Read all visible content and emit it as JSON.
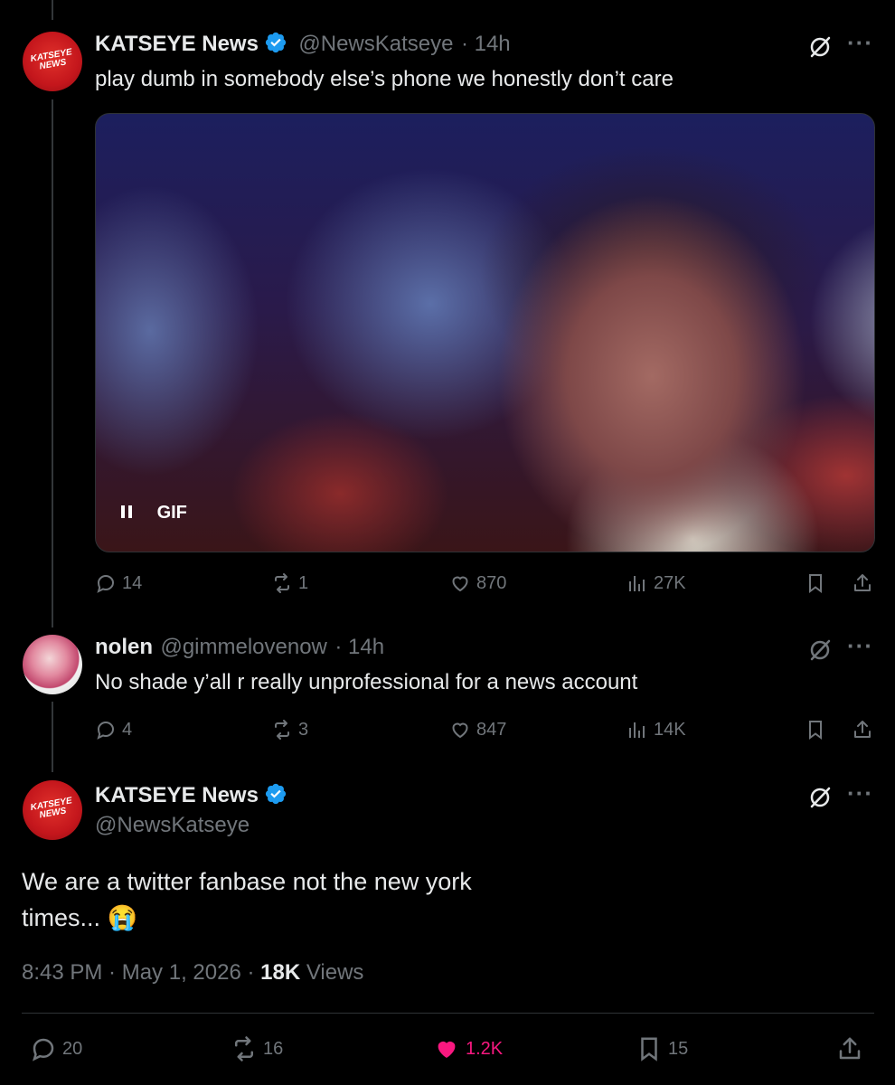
{
  "colors": {
    "background": "#000000",
    "text": "#e7e9ea",
    "muted": "#71767b",
    "verified": "#1d9bf0",
    "like_active": "#f91880"
  },
  "tweet1": {
    "name": "KATSEYE News",
    "handle": "@NewsKatseye",
    "time": "· 14h",
    "text": "play dumb in somebody else’s phone we honestly don’t care",
    "media_badge": "GIF",
    "avatar_text": "KATSEYE NEWS",
    "actions": {
      "replies": "14",
      "retweets": "1",
      "likes": "870",
      "views": "27K"
    }
  },
  "tweet2": {
    "name": "nolen",
    "handle": "@gimmelovenow",
    "time": "· 14h",
    "text": "No shade y’all r really unprofessional for a news account",
    "actions": {
      "replies": "4",
      "retweets": "3",
      "likes": "847",
      "views": "14K"
    }
  },
  "tweet3": {
    "name": "KATSEYE News",
    "handle": "@NewsKatseye",
    "avatar_text": "KATSEYE NEWS",
    "text_line1": "We are a twitter fanbase not the new york",
    "text_line2": "times...",
    "emoji": "😭",
    "meta_time": "8:43 PM · May 1, 2026 · ",
    "meta_views_count": "18K",
    "meta_views_label": " Views",
    "actions": {
      "replies": "20",
      "retweets": "16",
      "likes": "1.2K",
      "bookmarks": "15"
    }
  },
  "icons": [
    "reply-icon",
    "retweet-icon",
    "like-icon",
    "views-icon",
    "bookmark-icon",
    "share-icon",
    "grok-icon",
    "more-icon",
    "verified-icon",
    "pause-icon"
  ]
}
